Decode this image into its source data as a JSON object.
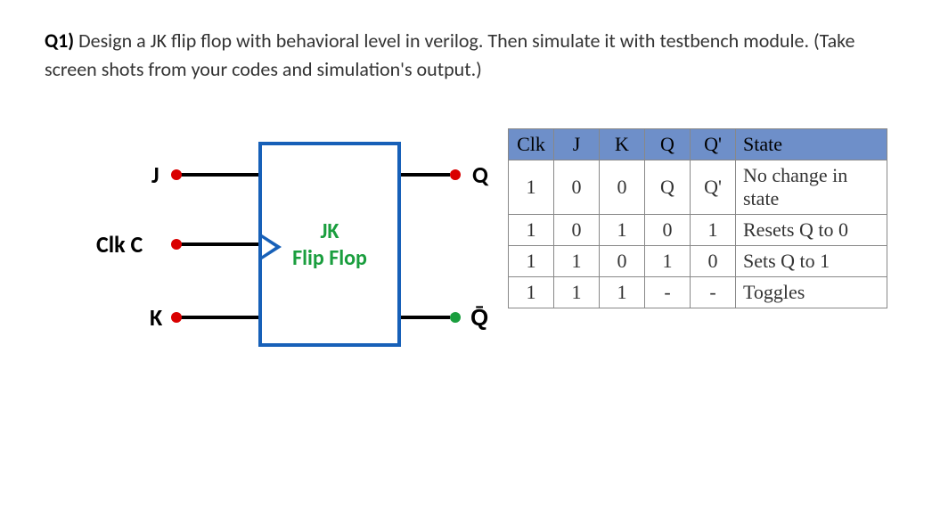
{
  "question": {
    "label": "Q1)",
    "text": " Design a JK flip flop with behavioral level in verilog. Then simulate it with testbench module. (Take screen shots from your codes and simulation's output.)"
  },
  "diagram": {
    "label_top": "JK",
    "label_bottom": "Flip Flop",
    "pins": {
      "j": "J",
      "clk": "Clk C",
      "k": "K",
      "q": "Q",
      "qbar": "Q̄"
    }
  },
  "chart_data": {
    "type": "table",
    "headers": [
      "Clk",
      "J",
      "K",
      "Q",
      "Q'",
      "State"
    ],
    "rows": [
      [
        "1",
        "0",
        "0",
        "Q",
        "Q'",
        "No change in state"
      ],
      [
        "1",
        "0",
        "1",
        "0",
        "1",
        "Resets Q to 0"
      ],
      [
        "1",
        "1",
        "0",
        "1",
        "0",
        "Sets Q to 1"
      ],
      [
        "1",
        "1",
        "1",
        "-",
        "-",
        "Toggles"
      ]
    ]
  }
}
